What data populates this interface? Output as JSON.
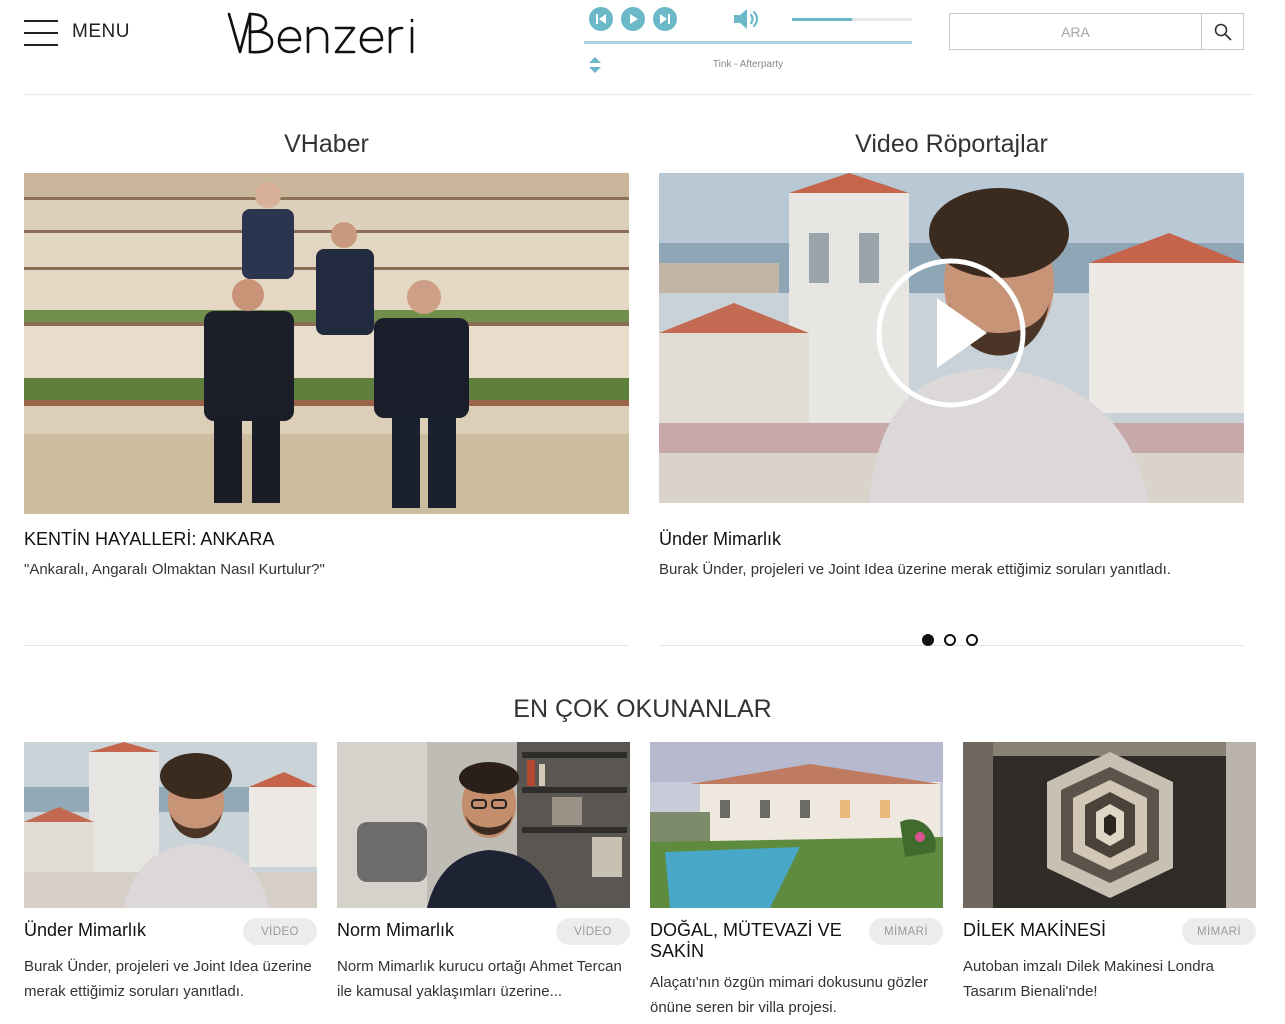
{
  "header": {
    "menu_label": "MENU",
    "logo_text": "VBENZERİ",
    "search": {
      "placeholder": "ARA"
    }
  },
  "player": {
    "track": "Tink - Afterparty",
    "volume_level": 0.5,
    "progress": 1.0,
    "accent_color": "#6bb8c8"
  },
  "featured": {
    "left": {
      "section": "VHaber",
      "title": "KENTİN HAYALLERİ: ANKARA",
      "description": "\"Ankaralı, Angaralı Olmaktan Nasıl Kurtulur?\""
    },
    "right": {
      "section": "Video Röportajlar",
      "title": "Ünder Mimarlık",
      "description": "Burak Ünder, projeleri ve Joint Idea üzerine merak ettiğimiz soruları yanıtladı."
    },
    "carousel_active_index": 0,
    "carousel_count": 3
  },
  "most_read": {
    "heading": "EN ÇOK OKUNANLAR",
    "cards": [
      {
        "title": "Ünder Mimarlık",
        "badge": "VİDEO",
        "description": "Burak Ünder, projeleri ve Joint Idea üzerine merak ettiğimiz soruları yanıtladı."
      },
      {
        "title": "Norm Mimarlık",
        "badge": "VİDEO",
        "description": "Norm Mimarlık kurucu ortağı Ahmet Tercan ile kamusal yaklaşımları üzerine..."
      },
      {
        "title": "DOĞAL, MÜTEVAZİ VE SAKİN",
        "badge": "MİMARİ",
        "description": "Alaçatı'nın özgün mimari dokusunu gözler önüne seren bir villa projesi."
      },
      {
        "title": "DİLEK MAKİNESİ",
        "badge": "MİMARİ",
        "description": "Autoban imzalı Dilek Makinesi Londra Tasarım Bienali'nde!"
      }
    ]
  }
}
